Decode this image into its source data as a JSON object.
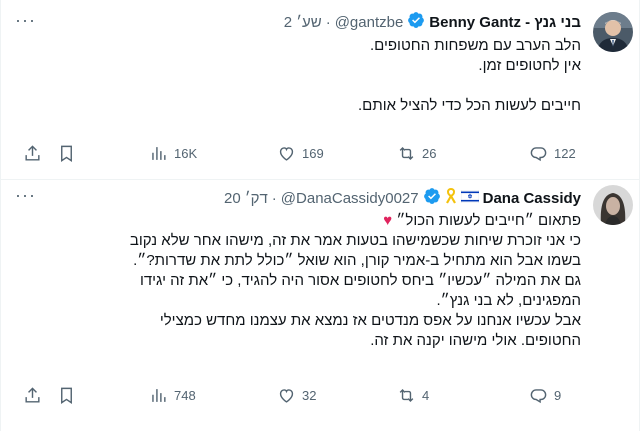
{
  "colors": {
    "verified": "#1d9bf0",
    "text": "#0f1419",
    "secondary": "#536471",
    "heart": "#e0245e"
  },
  "tweets": [
    {
      "author": {
        "name": "Benny Gantz - בני גנץ",
        "handle": "@gantzbe",
        "dot": "·",
        "time": "שע׳ 2",
        "verified": true
      },
      "more": "···",
      "body": [
        "הלב הערב עם משפחות החטופים.",
        "אין לחטופים זמן.",
        "",
        "חייבים לעשות הכל כדי להציל אותם."
      ],
      "stats": {
        "replies": "122",
        "retweets": "26",
        "likes": "169",
        "views": "16K"
      }
    },
    {
      "author": {
        "name": "Dana Cassidy",
        "handle": "@DanaCassidy0027",
        "dot": "·",
        "time": "דק׳ 20",
        "verified": true
      },
      "more": "···",
      "body_heart_line": "פתאום ״חייבים לעשות הכול״",
      "heart_glyph": "♥",
      "body": [
        "כי אני זוכרת שיחות שכשמישהו בטעות אמר את זה, מישהו אחר שלא נקוב",
        "בשמו אבל הוא מתחיל ב-אמיר קורן, הוא שואל ״כולל לתת את שדרות?״.",
        "גם את המילה ״עכשיו״ ביחס לחטופים אסור היה להגיד, כי ״את זה יגידו",
        "המפגינים, לא בני גנץ״.",
        "אבל עכשיו אנחנו על אפס מנדטים אז נמצא את עצמנו מחדש כמצילי",
        "החטופים. אולי מישהו יקנה את זה."
      ],
      "stats": {
        "replies": "9",
        "retweets": "4",
        "likes": "32",
        "views": "748"
      }
    }
  ]
}
